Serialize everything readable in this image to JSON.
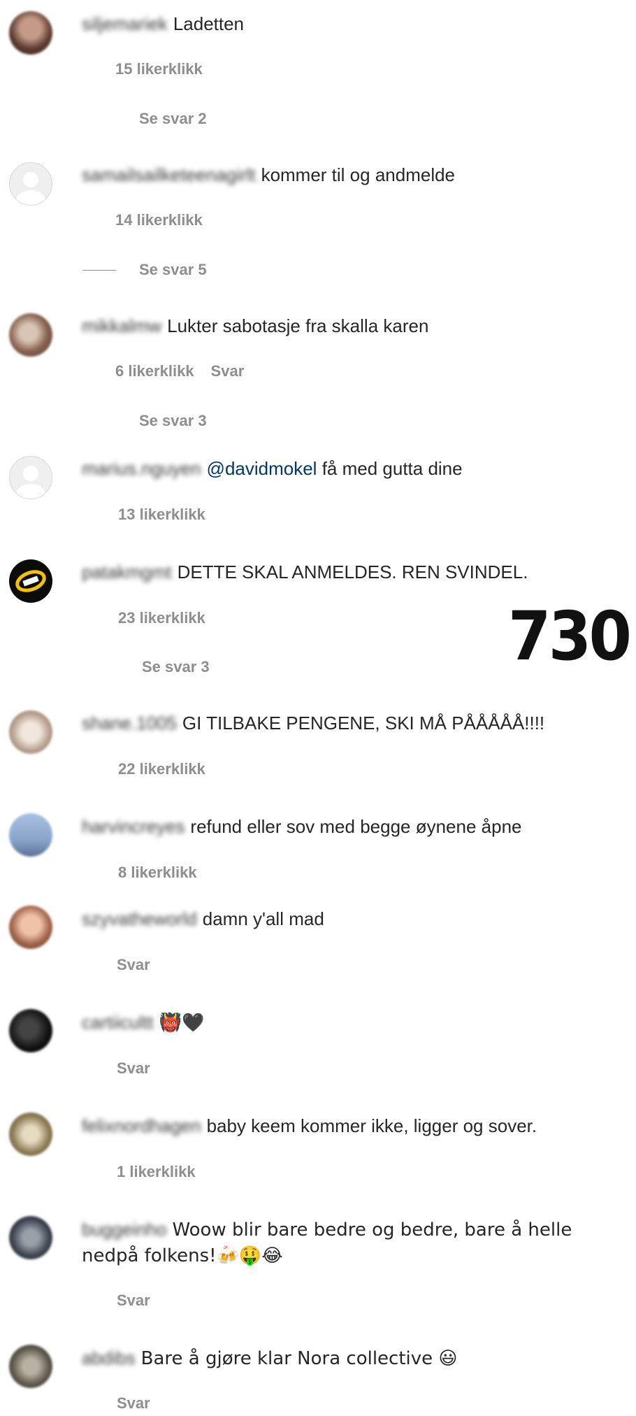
{
  "counter": "730",
  "comments": [
    {
      "username": "siljemariek",
      "text": "Ladetten",
      "likes": "15 likerklikk",
      "see_replies": "Se svar 2"
    },
    {
      "username": "samailsailketeenagirlt",
      "text": "kommer til og andmelde",
      "likes": "14 likerklikk",
      "see_replies": "Se svar 5"
    },
    {
      "username": "mikkalmw",
      "text": "Lukter sabotasje fra skalla karen",
      "likes": "6 likerklikk",
      "reply": "Svar",
      "see_replies": "Se svar 3"
    },
    {
      "username": "marius.nguyen",
      "mention": "@davidmokel",
      "text": "få med gutta dine",
      "likes": "13 likerklikk"
    },
    {
      "username": "patakmgmt",
      "text": "DETTE SKAL ANMELDES. REN SVINDEL.",
      "likes": "23 likerklikk",
      "see_replies": "Se svar 3"
    },
    {
      "username": "shane.1005",
      "text": "GI TILBAKE PENGENE, SKI MÅ PÅÅÅÅÅ!!!!",
      "likes": "22 likerklikk"
    },
    {
      "username": "harvincreyes",
      "text": "refund eller sov med begge øynene åpne",
      "likes": "8 likerklikk"
    },
    {
      "username": "szyvatheworld",
      "text": "damn y'all mad",
      "reply": "Svar"
    },
    {
      "username": "cartiicultt",
      "text": "👹🖤",
      "reply": "Svar"
    },
    {
      "username": "felixnordhagen",
      "text": "baby keem kommer ikke, ligger og sover.",
      "likes": "1 likerklikk"
    },
    {
      "username": "buggeinho",
      "text": "Woow blir bare bedre og bedre, bare å helle nedpå folkens!🍻🤑😂",
      "reply": "Svar"
    },
    {
      "username": "abdibs",
      "text": "Bare å gjøre klar Nora collective 😃",
      "reply": "Svar"
    }
  ],
  "colors": {
    "text": "#262626",
    "meta": "#8e8e8e",
    "mention": "#00376b"
  }
}
